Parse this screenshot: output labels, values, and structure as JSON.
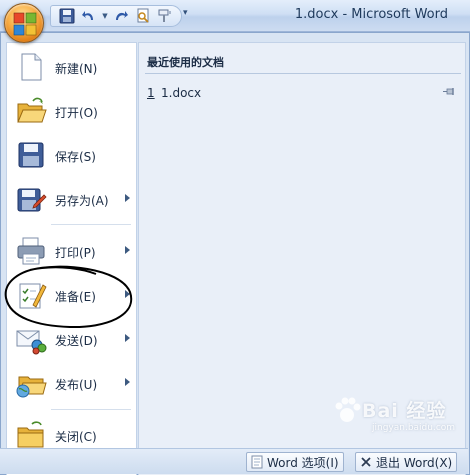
{
  "window": {
    "title": "1.docx - Microsoft Word"
  },
  "quick_access": {
    "buttons": [
      "save-icon",
      "undo-icon",
      "redo-icon",
      "print-preview-icon",
      "format-painter-icon"
    ],
    "customize": "▾"
  },
  "menu": {
    "items": [
      {
        "id": "new",
        "label": "新建(N)",
        "icon": "new-document-icon",
        "has_submenu": false
      },
      {
        "id": "open",
        "label": "打开(O)",
        "icon": "open-folder-icon",
        "has_submenu": false
      },
      {
        "id": "save",
        "label": "保存(S)",
        "icon": "save-icon",
        "has_submenu": false
      },
      {
        "id": "save-as",
        "label": "另存为(A)",
        "icon": "save-as-icon",
        "has_submenu": true
      },
      {
        "id": "print",
        "label": "打印(P)",
        "icon": "printer-icon",
        "has_submenu": true
      },
      {
        "id": "prepare",
        "label": "准备(E)",
        "icon": "prepare-icon",
        "has_submenu": true
      },
      {
        "id": "send",
        "label": "发送(D)",
        "icon": "send-icon",
        "has_submenu": true
      },
      {
        "id": "publish",
        "label": "发布(U)",
        "icon": "publish-icon",
        "has_submenu": true
      },
      {
        "id": "close",
        "label": "关闭(C)",
        "icon": "close-folder-icon",
        "has_submenu": false
      }
    ]
  },
  "recent": {
    "title": "最近使用的文档",
    "items": [
      {
        "number": "1",
        "name": "1.docx",
        "pin_icon": "pin-icon"
      }
    ]
  },
  "footer": {
    "options_label": "Word 选项(I)",
    "exit_label": "退出 Word(X)"
  },
  "watermark": {
    "brand": "Bai 经验",
    "url": "jingyan.baidu.com"
  },
  "colors": {
    "accent_orange": "#f9b24a",
    "menu_background": "#d8e4f3",
    "recent_pane": "#e9eff8",
    "annotation_ink": "#000000"
  }
}
